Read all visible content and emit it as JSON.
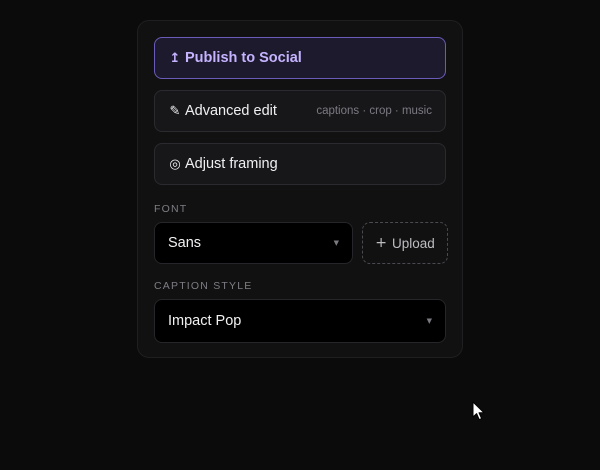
{
  "actions": {
    "publish": {
      "icon": "↥",
      "label": "Publish to Social"
    },
    "advanced_edit": {
      "icon": "✎",
      "label": "Advanced edit",
      "hint": "captions · crop · music"
    },
    "adjust_framing": {
      "icon": "◎",
      "label": "Adjust framing"
    }
  },
  "font": {
    "section_label": "FONT",
    "selected": "Sans",
    "caret": "▼",
    "upload_icon": "+",
    "upload_label": "Upload"
  },
  "caption_style": {
    "section_label": "CAPTION STYLE",
    "selected": "Impact Pop",
    "caret": "▼"
  },
  "colors": {
    "accent": "#c6b3ff",
    "accent_border": "#6b5bb8",
    "background": "#0b0b0b"
  },
  "icons": {
    "publish": "upload-arrow-icon",
    "advanced_edit": "pencil-icon",
    "adjust_framing": "target-icon",
    "upload": "plus-icon",
    "caret": "chevron-down-icon",
    "cursor": "mouse-pointer-icon"
  }
}
